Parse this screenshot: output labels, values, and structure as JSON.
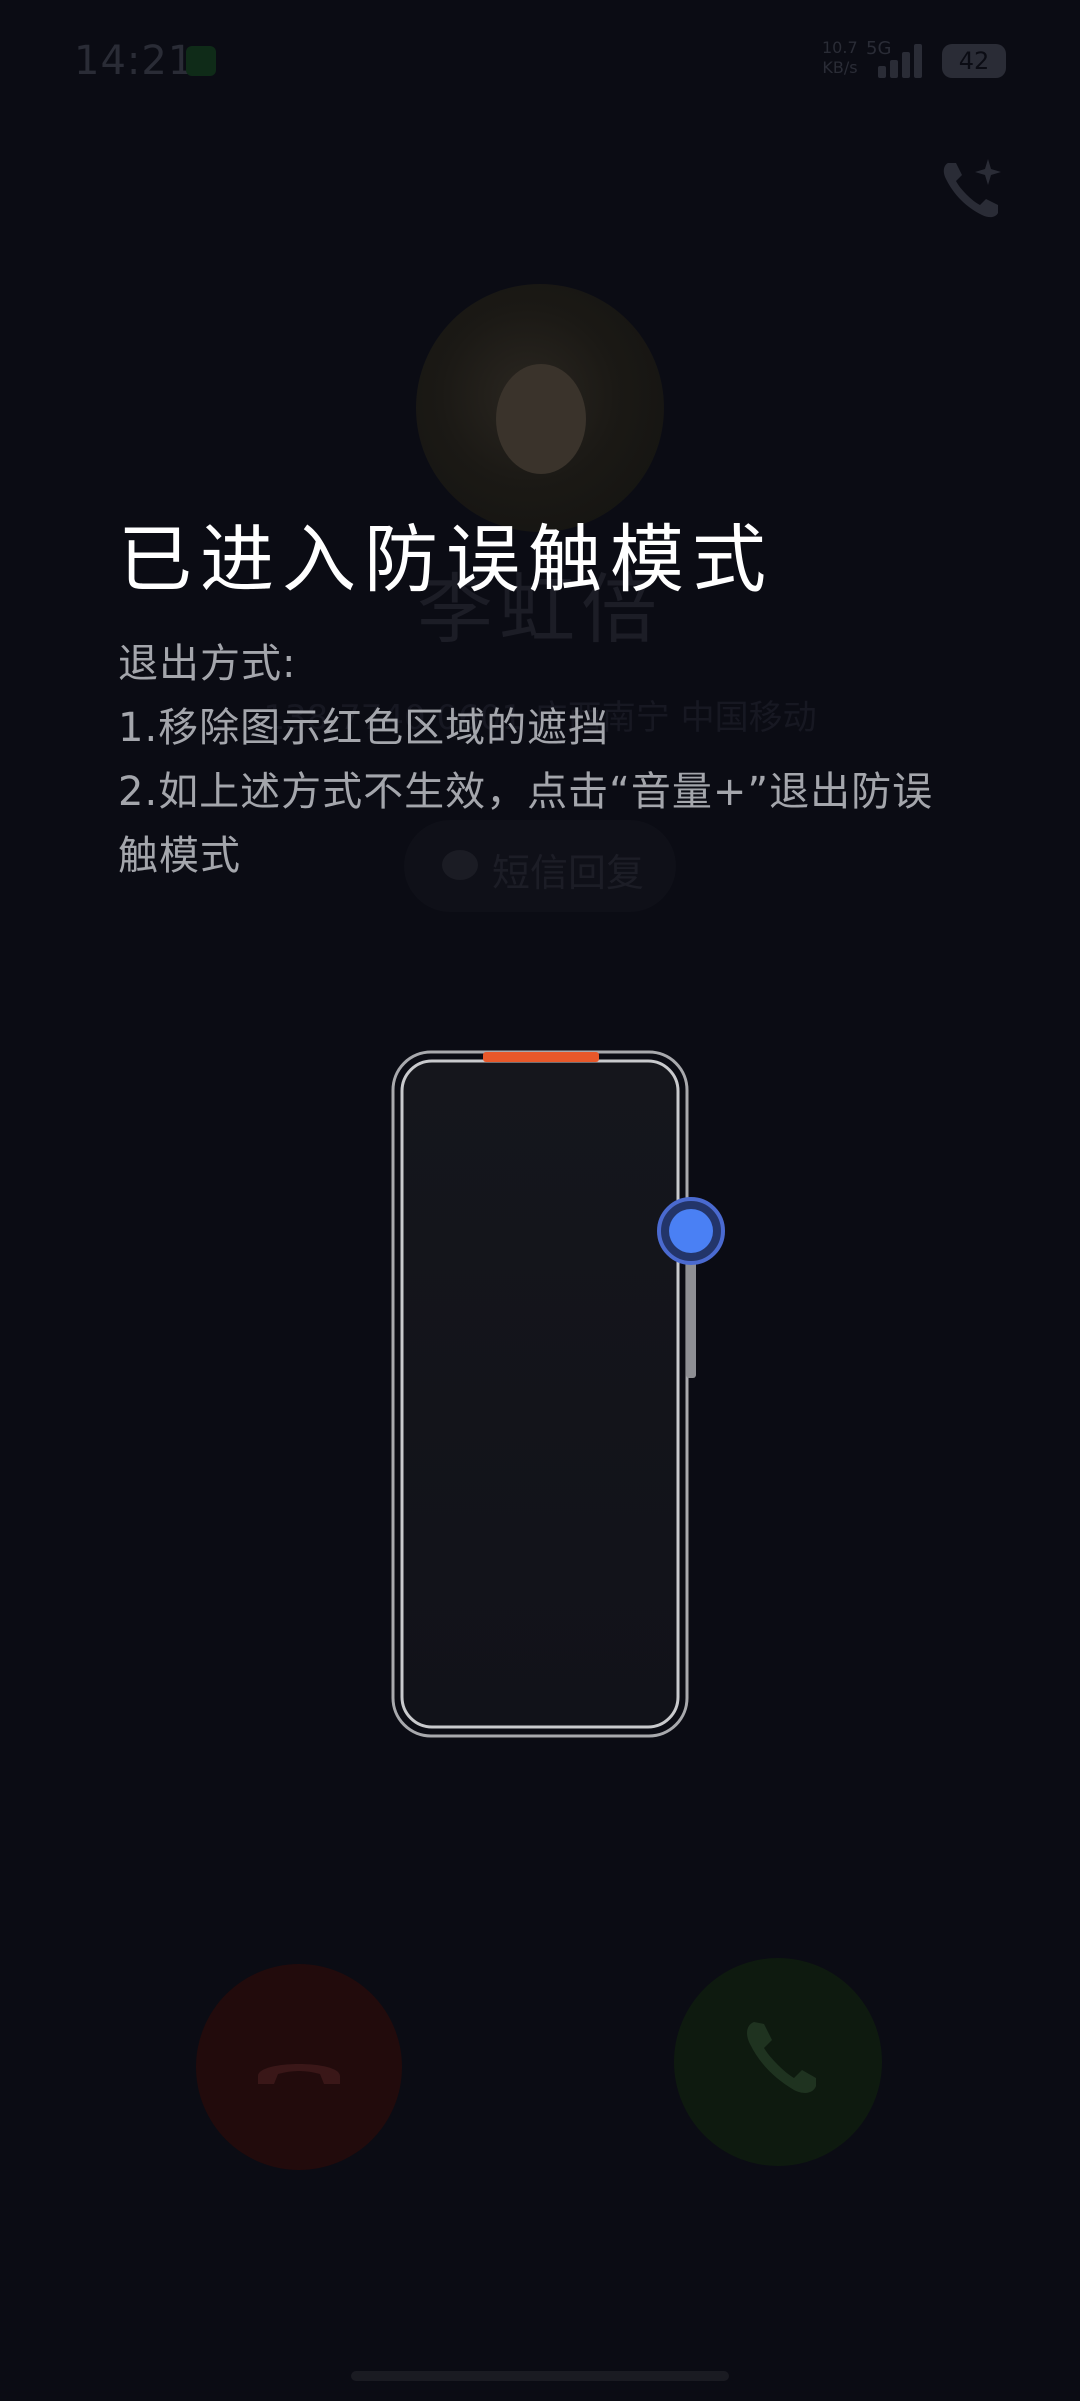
{
  "status_bar": {
    "time": "14:21",
    "net_speed_value": "10.7",
    "net_speed_unit": "KB/s",
    "net_type": "5G",
    "battery": "42"
  },
  "call": {
    "caller_name": "李虹倍",
    "caller_info": "138 7740 0601 广西南宁 中国移动",
    "sms_reply_label": "短信回复"
  },
  "overlay": {
    "title": "已进入防误触模式",
    "body": [
      "退出方式:",
      "1.移除图示红色区域的遮挡",
      "2.如上述方式不生效，点击“音量+”退出防误",
      "触模式"
    ]
  },
  "colors": {
    "sensor_highlight": "#e8582a",
    "volume_dot": "#4a80f4",
    "decline": "#220b0c",
    "accept": "#0e1a0f"
  },
  "icons": [
    "sim-icon",
    "signal-icon",
    "battery-icon",
    "add-call-icon",
    "message-icon",
    "decline-call-icon",
    "accept-call-icon",
    "volume-up-indicator-icon"
  ]
}
